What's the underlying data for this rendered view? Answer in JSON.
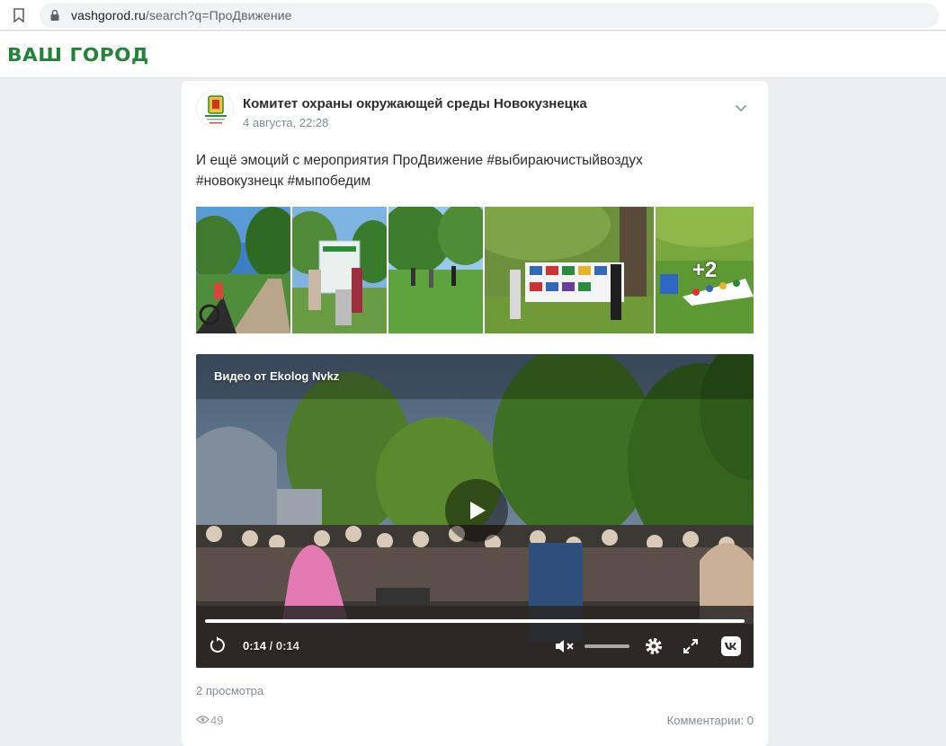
{
  "browser": {
    "url_host": "vashgorod.ru",
    "url_rest": "/search?q=ПроДвижение"
  },
  "site": {
    "logo_text": "ВАШ ГОРОД",
    "brand_color": "#21843a"
  },
  "post": {
    "author": "Комитет охраны окружающей среды Новокузнецка",
    "date": "4 августа, 22:28",
    "text_line1": "И ещё эмоций с мероприятия ПроДвижение #выбираючистыйвоздух",
    "text_line2": "#новокузнецк #мыпобедим",
    "photos": [
      {
        "name": "photo-park-cyclists",
        "icon": "photo"
      },
      {
        "name": "photo-banner-stroller",
        "icon": "photo"
      },
      {
        "name": "photo-lawn-games",
        "icon": "photo"
      },
      {
        "name": "photo-drawings-exhibit",
        "icon": "photo"
      },
      {
        "name": "photo-twister-mat",
        "icon": "photo",
        "more_label": "+2"
      }
    ],
    "video": {
      "title": "Видео от Ekolog Nvkz",
      "time_current": "0:14",
      "time_separator": " / ",
      "time_total": "0:14",
      "progress": 1.0,
      "muted": true
    },
    "views_text": "2 просмотра",
    "views_count": "49",
    "comments_text": "Комментарии: 0"
  }
}
